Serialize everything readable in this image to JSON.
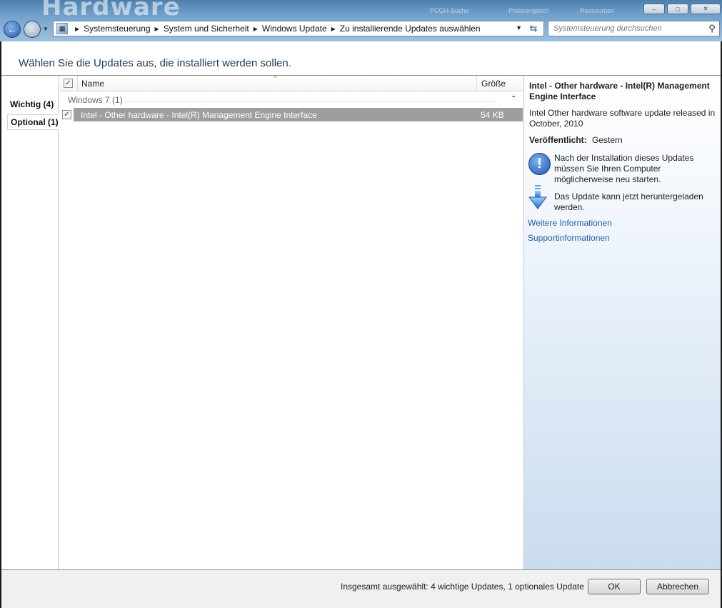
{
  "colors": {
    "accent": "#1f5fa8",
    "selection_row": "#9e9e9e",
    "chrome_blue": "#6b9cc8"
  },
  "chrome": {
    "background_logo": "Hardware",
    "background_links": [
      "PCGH-Suche",
      "Preisvergleich",
      "Ressourcen"
    ],
    "window_buttons": [
      "minimize-icon",
      "maximize-icon",
      "close-icon"
    ]
  },
  "nav": {
    "back_icon": "back-arrow-icon",
    "forward_icon": "forward-arrow-icon"
  },
  "address": {
    "breadcrumbs": [
      "Systemsteuerung",
      "System und Sicherheit",
      "Windows Update",
      "Zu installierende Updates auswählen"
    ]
  },
  "search": {
    "placeholder": "Systemsteuerung durchsuchen"
  },
  "page": {
    "heading": "Wählen Sie die Updates aus, die installiert werden sollen."
  },
  "left_tabs": [
    {
      "label": "Wichtig (4)",
      "selected": false
    },
    {
      "label": "Optional (1)",
      "selected": true
    }
  ],
  "list": {
    "columns": {
      "name": "Name",
      "size": "Größe"
    },
    "group": "Windows 7 (1)",
    "rows": [
      {
        "name": "Intel - Other hardware - Intel(R) Management Engine Interface",
        "size": "54 KB",
        "checked": true,
        "selected": true
      }
    ]
  },
  "details": {
    "title": "Intel - Other hardware - Intel(R) Management Engine Interface",
    "description": "Intel Other hardware software update released in October, 2010",
    "published_label": "Veröffentlicht:",
    "published_value": "Gestern",
    "restart_note": "Nach der Installation dieses Updates müssen Sie Ihren Computer möglicherweise neu starten.",
    "download_note": "Das Update kann jetzt heruntergeladen werden.",
    "links": [
      "Weitere Informationen",
      "Supportinformationen"
    ]
  },
  "footer": {
    "summary": "Insgesamt ausgewählt: 4 wichtige Updates, 1 optionales Update",
    "ok_label": "OK",
    "cancel_label": "Abbrechen"
  }
}
